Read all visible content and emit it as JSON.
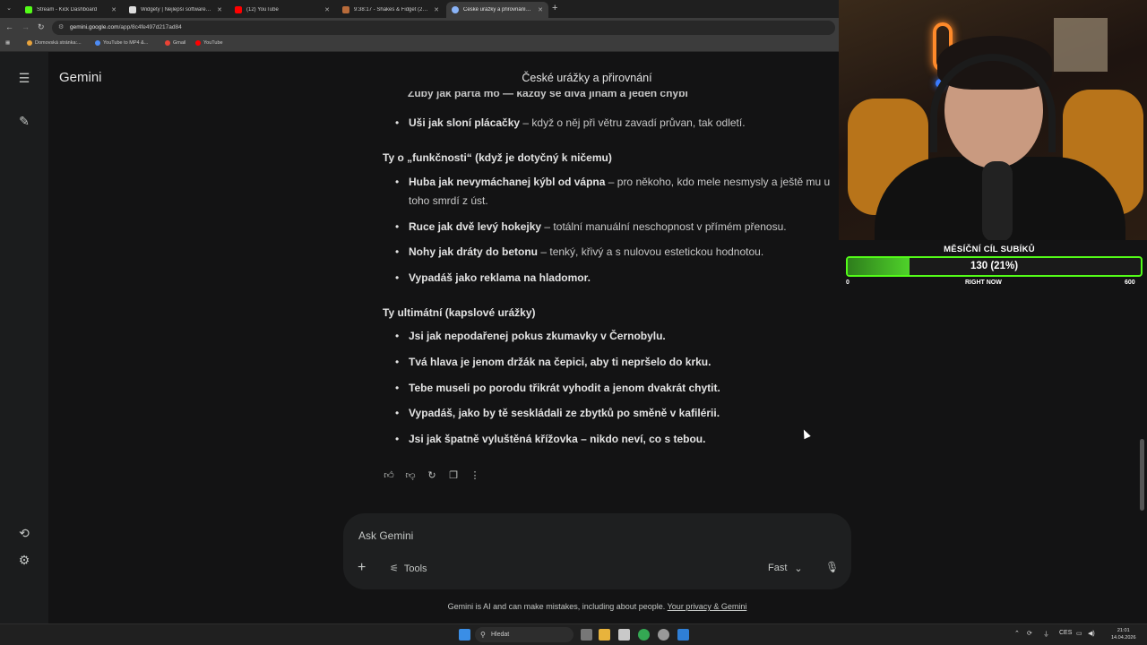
{
  "browser": {
    "tabs": [
      {
        "label": "Stream - Kick Dashboard",
        "color": "#53fc18",
        "active": false
      },
      {
        "label": "Widgety | Nejlepší software pro...",
        "color": "#dddddd",
        "active": false
      },
      {
        "label": "(12) YouTube",
        "color": "#ff0000",
        "active": false
      },
      {
        "label": "9:38:17 - Shakes & Fidget (29.7...",
        "color": "#b86b3a",
        "active": false
      },
      {
        "label": "České urážky a přirovnání - Go...",
        "color": "#8ab4f8",
        "active": true
      }
    ],
    "new_tab": "+",
    "url_host": "gemini.google.com",
    "url_path": "/app/8c4fe497d217ad84",
    "bookmarks": [
      {
        "label": "Domovská stránka:...",
        "color": "#e8a33c"
      },
      {
        "label": "YouTube to MP4 &...",
        "color": "#4d8cf5"
      },
      {
        "label": "Gmail",
        "color": "#ea4335"
      },
      {
        "label": "YouTube",
        "color": "#ff0000"
      }
    ]
  },
  "gemini": {
    "brand": "Gemini",
    "chat_title": "České urážky a přirovnání",
    "cutoff_text": "Zuby jak parta mo — každý se dívá jinam a jeden chybí",
    "item_ears_bold": "Uši jak sloní plácačky",
    "item_ears_rest": " – když o něj při větru zavadí průvan, tak odletí.",
    "section1_heading": "Ty o „funkčnosti“ (když je dotyčný k ničemu)",
    "section1_items": [
      {
        "bold": "Huba jak nevymáchanej kýbl od vápna",
        "rest": " – pro někoho, kdo mele nesmysly a ještě mu u",
        "rest2": "toho smrdí z úst."
      },
      {
        "bold": "Ruce jak dvě levý hokejky",
        "rest": " – totální manuální neschopnost v přímém přenosu."
      },
      {
        "bold": "Nohy jak dráty do betonu",
        "rest": " – tenký, křivý a s nulovou estetickou hodnotou."
      },
      {
        "bold": "Vypadáš jako reklama na hladomor.",
        "rest": ""
      }
    ],
    "section2_heading": "Ty ultimátní (kapslové urážky)",
    "section2_items": [
      "Jsi jak nepodařenej pokus zkumavky v Černobylu.",
      "Tvá hlava je jenom držák na čepici, aby ti nepršelo do krku.",
      "Tebe museli po porodu třikrát vyhodit a jenom dvakrát chytit.",
      "Vypadáš, jako by tě seskládali ze zbytků po směně v kafilérii.",
      "Jsi jak špatně vyluštěná křížovka – nikdo neví, co s tebou."
    ],
    "input_placeholder": "Ask Gemini",
    "tools_label": "Tools",
    "model_label": "Fast",
    "disclaimer": "Gemini is AI and can make mistakes, including about people.",
    "privacy_link": "Your privacy & Gemini"
  },
  "goal": {
    "title": "MĚSÍČNÍ CÍL SUBÍKŮ",
    "bar_text": "130 (21%)",
    "fraction": 0.21,
    "min_label": "0",
    "center_label": "RIGHT NOW",
    "max_label": "600"
  },
  "taskbar": {
    "search_label": "Hledat",
    "lang": "CES",
    "time": "21:01",
    "date": "14.04.2026"
  }
}
